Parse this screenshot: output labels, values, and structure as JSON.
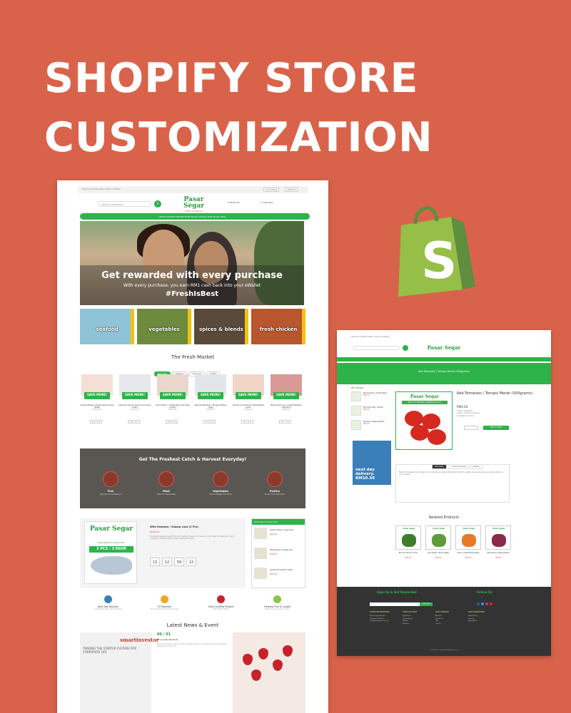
{
  "headline": {
    "line1": "SHOPIFY STORE",
    "line2": "CUSTOMIZATION"
  },
  "colors": {
    "background": "#d9634a",
    "accent_green": "#2db34a",
    "shopify_green": "#95bf47"
  },
  "left_screenshot": {
    "topbar": {
      "welcome": "Welcome To Pasar Segar / Fresh Ink Market",
      "btn1": "Account/Log",
      "btn2": "Checkout"
    },
    "search_placeholder": "Search Our Fresh Stores",
    "logo": {
      "name": "Pasar Segar",
      "tagline": "Fresh Ink Market"
    },
    "contact": {
      "email_label": "Email Us",
      "cart_label": "Cart Item"
    },
    "nav_items": "FRESH MARKET    PROMOTION    PASAR SEGAR APPS    BLOG INFO",
    "hero": {
      "title": "Get rewarded with every purchase",
      "subtitle": "With every purchase, you earn RM1 cash back into your eWallet",
      "tag": "#FreshIsBest"
    },
    "categories": [
      "seafood",
      "vegetables",
      "spices & blends",
      "fresh chicken"
    ],
    "section_fresh_market": "The Fresh Market",
    "tabs": [
      "Best Seller",
      "Seafood",
      "Fruit & Veg",
      "Poultry"
    ],
    "products": [
      {
        "name": "Chicken Breast | Dada Ayam Goreng (Fillet)",
        "price": "RM12.90",
        "badge": "SAVE MORE!"
      },
      {
        "name": "Wild Sea Squid | Sotong Lord (ikan Fresh)",
        "price": "RM22.90",
        "badge": "SAVE MORE!"
      },
      {
        "name": "Grey Prawns | Udang Belo Gali (Tiger Prawn)",
        "price": "RM39.90",
        "badge": "SAVE MORE!"
      },
      {
        "name": "Spanish Mackerel | Tenggiri Batang (1kg)",
        "price": "RM26.90",
        "badge": "SAVE MORE!"
      },
      {
        "name": "Chicken Drumsticks | Peha Bawah Ayam",
        "price": "RM14.90",
        "badge": "SAVE MORE!"
      },
      {
        "name": "Beef Tender Loin | Daging Batang (Striploin)",
        "price": "RM58.00",
        "badge": "SAVE MORE!"
      }
    ],
    "banner": {
      "title": "Get The Freshest Catch & Harvest Everyday!",
      "items": [
        {
          "label": "Fish",
          "sub": "Fresh From Local Fishermen"
        },
        {
          "label": "Meat",
          "sub": "Halal and Freshest Meat"
        },
        {
          "label": "Vegetables",
          "sub": "Sourced Straight From Farms"
        },
        {
          "label": "Poultry",
          "sub": "Chicken From Fresh Farms"
        }
      ]
    },
    "deal": {
      "logo": "Pasar Segar",
      "promo_tagline": "WILD SEABASS / SIAKAP LAUT",
      "promo_big": "3 PCS / 3 EKOR",
      "title": "Wild Seabass / Siakap Laut (3 Pcs)",
      "price": "RM49.99",
      "desc": "Fresh wild seabass caught from local waters. Cleaned and ready to cook. Best for steaming, frying or grilling. Limited time promotion while stocks last.",
      "countdown": [
        "13",
        "12",
        "59",
        "12"
      ]
    },
    "side_list": {
      "header": "Grab Sign To Save Here",
      "items": [
        {
          "name": "Chicken Whole / Ayam Utuh",
          "price": "RM16.90"
        },
        {
          "name": "Wild Seabass / Siakap Laut",
          "price": "RM49.99"
        },
        {
          "name": "Chicken Drumsticks / Peha",
          "price": "RM14.90"
        }
      ]
    },
    "usps": [
      {
        "title": "Next Day Delivery",
        "sub": "Order before 9pm, get it tomorrow"
      },
      {
        "title": "E5 Rewards",
        "sub": "Earn cashback with every purchase"
      },
      {
        "title": "Halal Certified Product",
        "sub": "100% Halal certified"
      },
      {
        "title": "Freshest Fine & Caught",
        "sub": "Fresh from source to your door"
      }
    ],
    "news": {
      "title": "Latest News & Event",
      "brand": "smartinvestor",
      "headline_text": "TRADING THE STARTUP CULTURE FOR CORPORATE LIFE",
      "date": "06 / 01",
      "post_title": "P1 Loyalty Rewards",
      "post_excerpt": "Earn points every time you shop with Pasar Segar and redeem them for exclusive rewards and discounts."
    }
  },
  "right_screenshot": {
    "banner": "Red Tomatoes / Tomato Merah (500grams)",
    "side_head": "BEST SELLERS",
    "thumbs": [
      {
        "name": "Red Tomatoes / Tomato Merah",
        "price": "RM4.50"
      },
      {
        "name": "Bird's Eye Chilli / Cili Padi",
        "price": "RM3.90"
      },
      {
        "name": "Red Onion / Bawang Merah",
        "price": "RM5.20"
      }
    ],
    "badge": "NEXT DAY DELIVERY | PREMIUM QUALITY",
    "title": "Red Tomatoes / Tomato Merah (500grams)",
    "price": "RM4.50",
    "meta": "Weight: 500grams\nOrigin: Cameron Highlands\nAvailability: In Stock",
    "add_to_cart": "ADD TO CART",
    "ad": {
      "line1": "next day",
      "line2": "delivery.",
      "line3": "RM10.50"
    },
    "tabs": [
      "Description",
      "Customer Review",
      "Recipes"
    ],
    "tab_content": "Fresh red tomatoes sourced daily from local farms in Cameron Highlands. Perfect for salads, sauces and everyday cooking. Store in a cool dry place.",
    "related_title": "Related Products",
    "related": [
      {
        "name": "Broccoli / Brokoli (1 Pcs)",
        "price": "RM6.90"
      },
      {
        "name": "Lady Fingers / Bendi (250g)",
        "price": "RM3.50"
      },
      {
        "name": "Carrot / Lobak Merah (500g)",
        "price": "RM2.90"
      },
      {
        "name": "Red Spinach / Bayam Merah",
        "price": "RM2.50"
      }
    ],
    "footer": {
      "signup": "Sign Up & Get Rewarded",
      "follow": "Follow Us",
      "subscribe": "SUBSCRIBE",
      "columns": [
        {
          "title": "STORE INFORMATION",
          "links": "Pasar Segar Sdn Bhd\nSelangor, Malaysia\ninfo@pasarsegar.com.my"
        },
        {
          "title": "YOUR ACCOUNT",
          "links": "My Account\nOrder History\nWishlist\nRewards"
        },
        {
          "title": "OUR COMPANY",
          "links": "About Us\nContact Us\nFAQ\nCareers"
        },
        {
          "title": "OUR WAREHOUSE",
          "links": "Klang Valley\nPenang\nJohor Bahru"
        }
      ],
      "copyright": "© 2021 Pasar Segar. All Rights Reserved."
    }
  }
}
